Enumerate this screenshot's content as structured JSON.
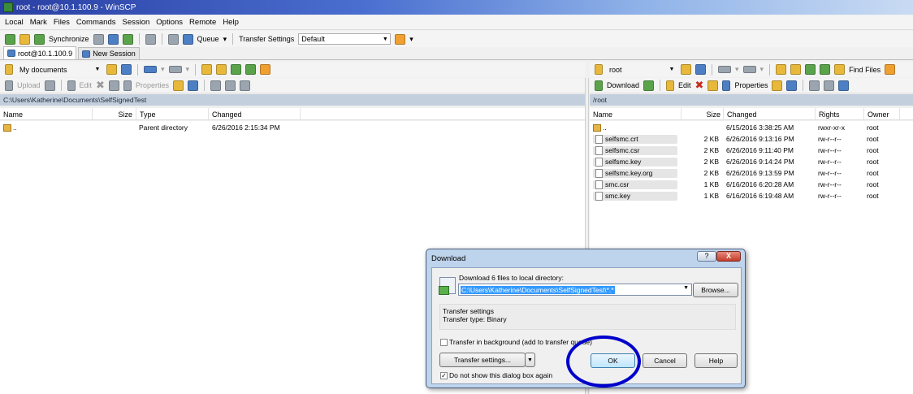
{
  "window": {
    "title": "root - root@10.1.100.9 - WinSCP"
  },
  "menu": [
    "Local",
    "Mark",
    "Files",
    "Commands",
    "Session",
    "Options",
    "Remote",
    "Help"
  ],
  "toolbar": {
    "synchronize": "Synchronize",
    "queue": "Queue",
    "transfer_settings_label": "Transfer Settings",
    "transfer_settings_value": "Default"
  },
  "tabs": [
    {
      "label": "root@10.1.100.9"
    },
    {
      "label": "New Session"
    }
  ],
  "left": {
    "location": "My documents",
    "toolbar": {
      "upload": "Upload",
      "edit": "Edit",
      "properties": "Properties"
    },
    "path": "C:\\Users\\Katherine\\Documents\\SelfSignedTest",
    "columns": {
      "name": "Name",
      "size": "Size",
      "type": "Type",
      "changed": "Changed"
    },
    "rows": [
      {
        "name": "..",
        "size": "",
        "type": "Parent directory",
        "changed": "6/26/2016 2:15:34 PM"
      }
    ]
  },
  "right": {
    "location": "root",
    "find_files": "Find Files",
    "toolbar": {
      "download": "Download",
      "edit": "Edit",
      "properties": "Properties"
    },
    "path": "/root",
    "columns": {
      "name": "Name",
      "size": "Size",
      "changed": "Changed",
      "rights": "Rights",
      "owner": "Owner"
    },
    "rows": [
      {
        "name": "..",
        "size": "",
        "changed": "6/15/2016 3:38:25 AM",
        "rights": "rwxr-xr-x",
        "owner": "root"
      },
      {
        "name": "selfsmc.crt",
        "size": "2 KB",
        "changed": "6/26/2016 9:13:16 PM",
        "rights": "rw-r--r--",
        "owner": "root"
      },
      {
        "name": "selfsmc.csr",
        "size": "2 KB",
        "changed": "6/26/2016 9:11:40 PM",
        "rights": "rw-r--r--",
        "owner": "root"
      },
      {
        "name": "selfsmc.key",
        "size": "2 KB",
        "changed": "6/26/2016 9:14:24 PM",
        "rights": "rw-r--r--",
        "owner": "root"
      },
      {
        "name": "selfsmc.key.org",
        "size": "2 KB",
        "changed": "6/26/2016 9:13:59 PM",
        "rights": "rw-r--r--",
        "owner": "root"
      },
      {
        "name": "smc.csr",
        "size": "1 KB",
        "changed": "6/16/2016 6:20:28 AM",
        "rights": "rw-r--r--",
        "owner": "root"
      },
      {
        "name": "smc.key",
        "size": "1 KB",
        "changed": "6/16/2016 6:19:48 AM",
        "rights": "rw-r--r--",
        "owner": "root"
      }
    ]
  },
  "dialog": {
    "title": "Download",
    "help_glyph": "?",
    "close_glyph": "X",
    "label": "Download 6 files to local directory:",
    "target": "C:\\Users\\Katherine\\Documents\\SelfSignedTest\\*.*",
    "browse": "Browse...",
    "settings_heading": "Transfer settings",
    "settings_type": "Transfer type: Binary",
    "background_label": "Transfer in background (add to transfer queue)",
    "transfer_settings_button": "Transfer settings...",
    "ok": "OK",
    "cancel": "Cancel",
    "help": "Help",
    "dont_show_label": "Do not show this dialog box again",
    "dont_show_checked": true
  }
}
